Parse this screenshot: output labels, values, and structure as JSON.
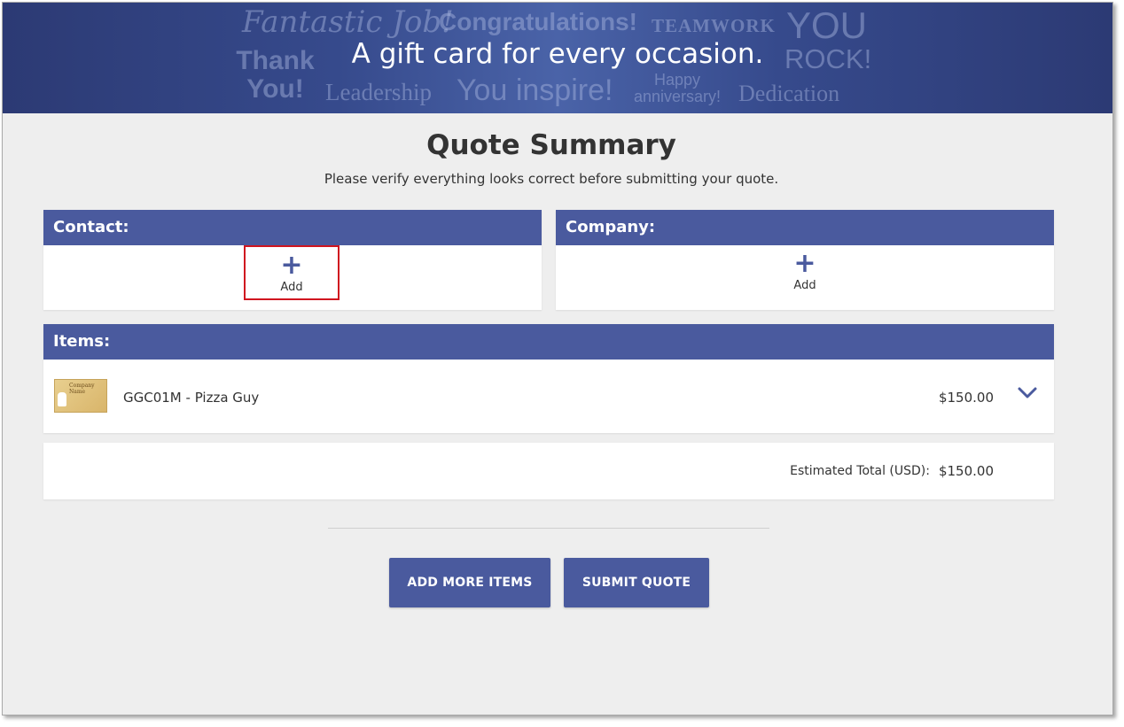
{
  "banner": {
    "tagline": "A gift card for every occasion.",
    "words": {
      "w1": "Fantastic Job!",
      "w2": "Congratulations!",
      "w3": "TEAMWORK",
      "w4": "YOU",
      "w5": "ROCK!",
      "w6": "Thank You!",
      "w7": "Leadership",
      "w8": "You inspire!",
      "w9": "Happy anniversary!",
      "w10": "Dedication"
    }
  },
  "page": {
    "title": "Quote Summary",
    "subtitle": "Please verify everything looks correct before submitting your quote."
  },
  "contact": {
    "header": "Contact:",
    "add_label": "Add",
    "add_icon": "plus-icon"
  },
  "company": {
    "header": "Company:",
    "add_label": "Add",
    "add_icon": "plus-icon"
  },
  "items": {
    "header": "Items:",
    "list": [
      {
        "thumbnail_text": "Company Name",
        "name": "GGC01M - Pizza Guy",
        "price": "$150.00",
        "expand_icon": "chevron-down-icon"
      }
    ]
  },
  "totals": {
    "label": "Estimated Total (USD):",
    "value": "$150.00"
  },
  "actions": {
    "add_more_items": "ADD MORE ITEMS",
    "submit_quote": "SUBMIT QUOTE"
  },
  "colors": {
    "accent": "#4a5a9e",
    "highlight": "#d0141f",
    "background": "#eeeeee"
  }
}
